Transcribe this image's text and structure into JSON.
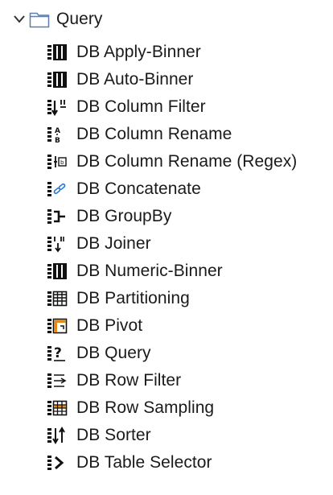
{
  "tree": {
    "folder": {
      "label": "Query",
      "icon": "folder-icon",
      "expanded": true
    },
    "items": [
      {
        "label": "DB Apply-Binner",
        "icon": "binner-icon"
      },
      {
        "label": "DB Auto-Binner",
        "icon": "binner-icon"
      },
      {
        "label": "DB Column Filter",
        "icon": "column-filter-icon"
      },
      {
        "label": "DB Column Rename",
        "icon": "column-rename-icon"
      },
      {
        "label": "DB Column Rename (Regex)",
        "icon": "column-rename-regex-icon"
      },
      {
        "label": "DB Concatenate",
        "icon": "concatenate-icon"
      },
      {
        "label": "DB GroupBy",
        "icon": "groupby-icon"
      },
      {
        "label": "DB Joiner",
        "icon": "joiner-icon"
      },
      {
        "label": "DB Numeric-Binner",
        "icon": "binner-icon"
      },
      {
        "label": "DB Partitioning",
        "icon": "partitioning-icon"
      },
      {
        "label": "DB Pivot",
        "icon": "pivot-icon"
      },
      {
        "label": "DB Query",
        "icon": "query-icon"
      },
      {
        "label": "DB Row Filter",
        "icon": "row-filter-icon"
      },
      {
        "label": "DB Row Sampling",
        "icon": "row-sampling-icon"
      },
      {
        "label": "DB Sorter",
        "icon": "sorter-icon"
      },
      {
        "label": "DB Table Selector",
        "icon": "table-selector-icon"
      }
    ]
  },
  "colors": {
    "folder_stroke": "#5f7fa6",
    "folder_fill": "#ffffff",
    "icon_dark": "#111111",
    "icon_blue": "#2b78d6",
    "icon_orange": "#e58a18",
    "chevron": "#333333"
  }
}
